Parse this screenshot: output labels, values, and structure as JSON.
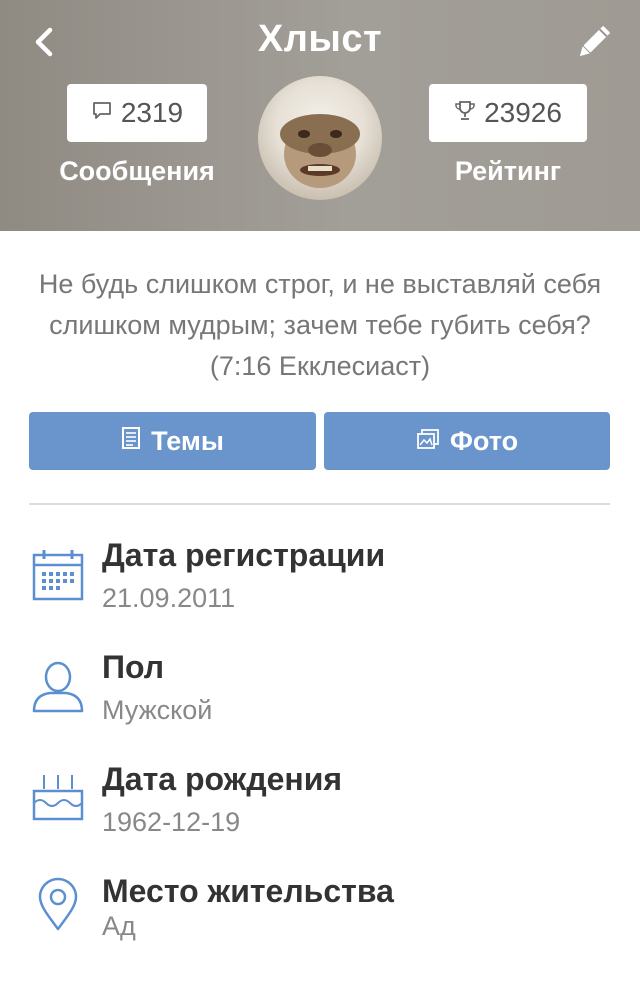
{
  "header": {
    "title": "Хлыст",
    "messages": {
      "count": "2319",
      "label": "Сообщения"
    },
    "rating": {
      "count": "23926",
      "label": "Рейтинг"
    }
  },
  "status_quote": "Не будь слишком строг, и не выставляй себя слишком мудрым; зачем тебе губить себя? (7:16 Екклесиаст)",
  "buttons": {
    "topics": "Темы",
    "photo": "Фото"
  },
  "info": [
    {
      "icon": "calendar-icon",
      "title": "Дата регистрации",
      "value": "21.09.2011"
    },
    {
      "icon": "person-icon",
      "title": "Пол",
      "value": "Мужской"
    },
    {
      "icon": "cake-icon",
      "title": "Дата рождения",
      "value": "1962-12-19"
    },
    {
      "icon": "location-pin-icon",
      "title": "Место жительства",
      "value": "Ад"
    }
  ],
  "colors": {
    "accent": "#6a94cc",
    "icon_blue": "#5b8fd0",
    "header_bg": "#9b9790"
  }
}
